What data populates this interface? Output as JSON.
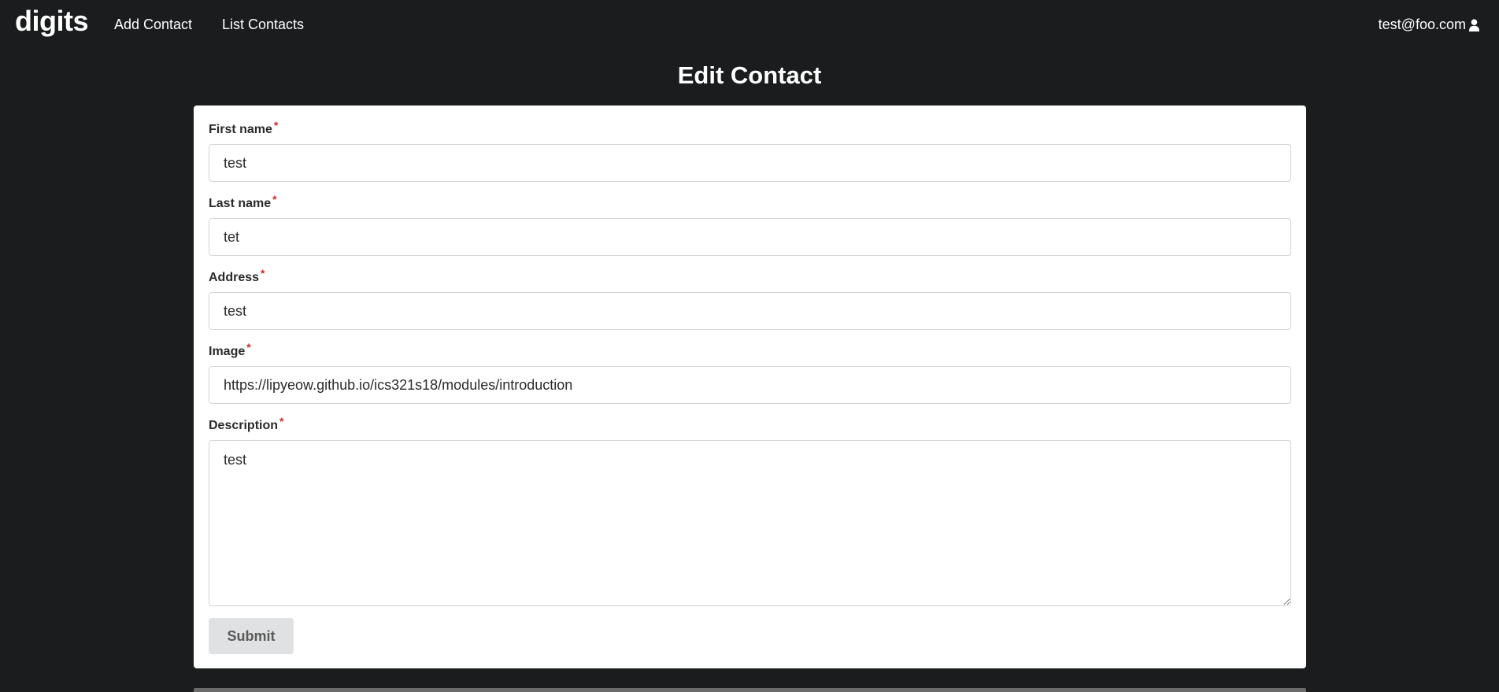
{
  "navbar": {
    "brand": "digits",
    "links": [
      {
        "label": "Add Contact"
      },
      {
        "label": "List Contacts"
      }
    ],
    "user_email": "test@foo.com",
    "user_icon": "user-icon"
  },
  "page": {
    "title": "Edit Contact"
  },
  "form": {
    "required_marker": "*",
    "fields": [
      {
        "label": "First name",
        "value": "test"
      },
      {
        "label": "Last name",
        "value": "tet"
      },
      {
        "label": "Address",
        "value": "test"
      },
      {
        "label": "Image",
        "value": "https://lipyeow.github.io/ics321s18/modules/introduction"
      },
      {
        "label": "Description",
        "value": "test"
      }
    ],
    "submit_label": "Submit"
  },
  "colors": {
    "background": "#1b1c1d",
    "card": "#ffffff",
    "required": "#db2828",
    "button": "#e0e1e2"
  }
}
